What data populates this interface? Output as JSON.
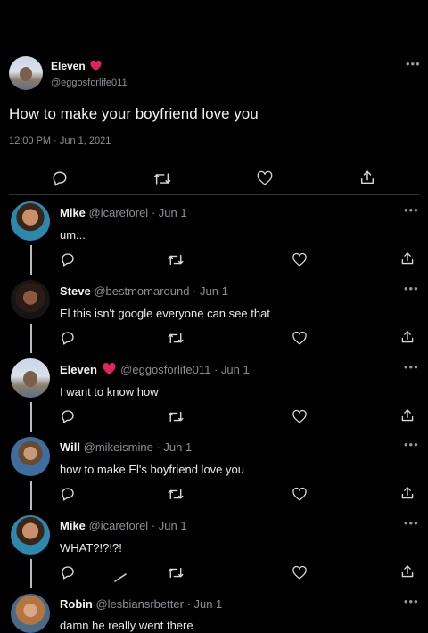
{
  "main_tweet": {
    "author_name": "Eleven",
    "heart_emoji": "❤️",
    "handle": "@eggosforlife011",
    "text": "How to make your boyfriend love you",
    "meta": "12:00 PM · Jun 1, 2021"
  },
  "replies": [
    {
      "name": "Mike",
      "handle": "@icareforel",
      "date": "· Jun 1",
      "text": "um..."
    },
    {
      "name": "Steve",
      "handle": "@bestmomaround",
      "date": "· Jun 1",
      "text": "El this isn't google everyone can see that"
    },
    {
      "name": "Eleven",
      "handle": "@eggosforlife011",
      "date": "· Jun 1",
      "text": "I want to know how"
    },
    {
      "name": "Will",
      "handle": "@mikeismine",
      "date": "· Jun 1",
      "text": "how to make El's boyfriend love you"
    },
    {
      "name": "Mike",
      "handle": "@icareforel",
      "date": "· Jun 1",
      "text": "WHAT?!?!?!"
    },
    {
      "name": "Robin",
      "handle": "@lesbiansrbetter",
      "date": "· Jun 1",
      "text": "damn he really went there"
    }
  ],
  "icons": {
    "reply": "reply-icon",
    "retweet": "retweet-icon",
    "like": "heart-icon",
    "share": "share-icon",
    "more": "more-options-icon"
  },
  "colors": {
    "background": "#000000",
    "text": "#e7e9ea",
    "muted": "#8b8f94",
    "heart": "#e0245e"
  }
}
